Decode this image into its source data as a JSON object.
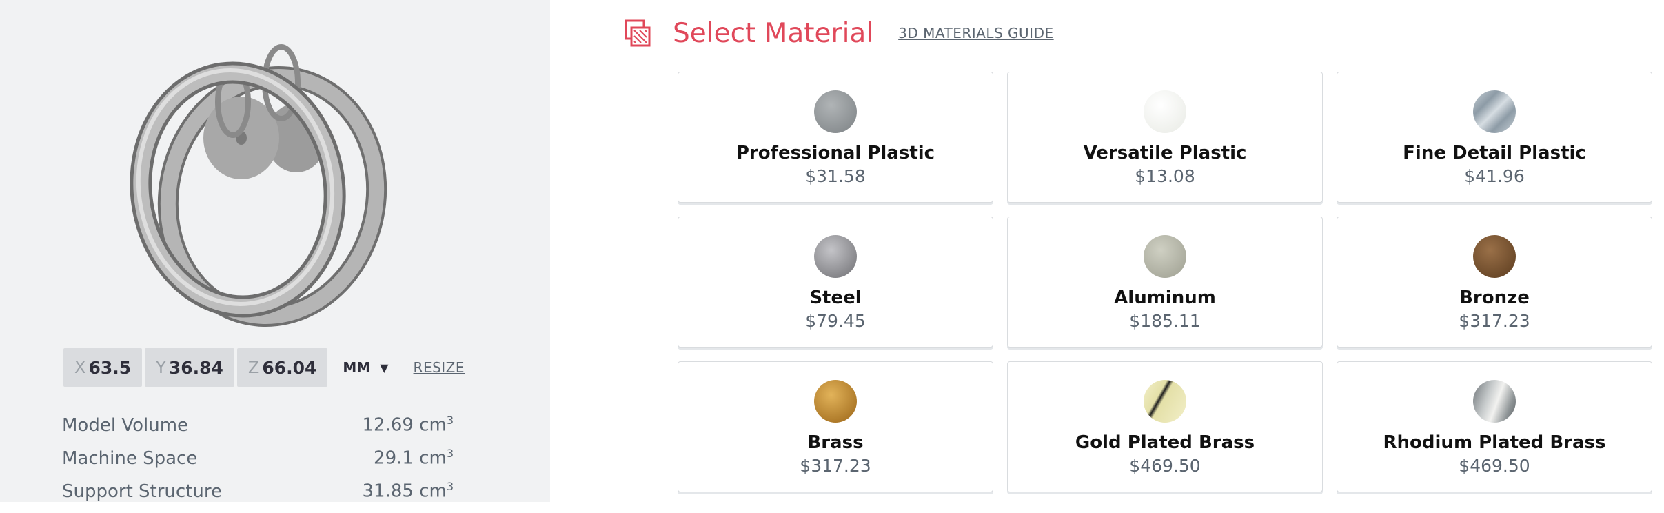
{
  "dimensions": {
    "x_label": "X",
    "x_value": "63.5",
    "y_label": "Y",
    "y_value": "36.84",
    "z_label": "Z",
    "z_value": "66.04",
    "unit": "MM",
    "resize_label": "RESIZE"
  },
  "stats": [
    {
      "label": "Model Volume",
      "value": "12.69 cm",
      "sup": "3"
    },
    {
      "label": "Machine Space",
      "value": "29.1 cm",
      "sup": "3"
    },
    {
      "label": "Support Structure",
      "value": "31.85 cm",
      "sup": "3"
    }
  ],
  "header": {
    "title": "Select Material",
    "guide_label": "3D MATERIALS GUIDE",
    "accent_color": "#e0485a"
  },
  "materials": [
    {
      "name": "Professional Plastic",
      "price": "$31.58",
      "swatch_color": "#8e9396"
    },
    {
      "name": "Versatile Plastic",
      "price": "$13.08",
      "swatch_color": "#f4f5f2"
    },
    {
      "name": "Fine Detail Plastic",
      "price": "$41.96",
      "swatch_color": "#a9b6c0"
    },
    {
      "name": "Steel",
      "price": "$79.45",
      "swatch_color": "#8a8a8e"
    },
    {
      "name": "Aluminum",
      "price": "$185.11",
      "swatch_color": "#b4b5a7"
    },
    {
      "name": "Bronze",
      "price": "$317.23",
      "swatch_color": "#6b4a2a"
    },
    {
      "name": "Brass",
      "price": "$317.23",
      "swatch_color": "#b27a25"
    },
    {
      "name": "Gold Plated Brass",
      "price": "$469.50",
      "swatch_color": "#e9e5b5"
    },
    {
      "name": "Rhodium Plated Brass",
      "price": "$469.50",
      "swatch_color": "#9da3a6"
    }
  ]
}
